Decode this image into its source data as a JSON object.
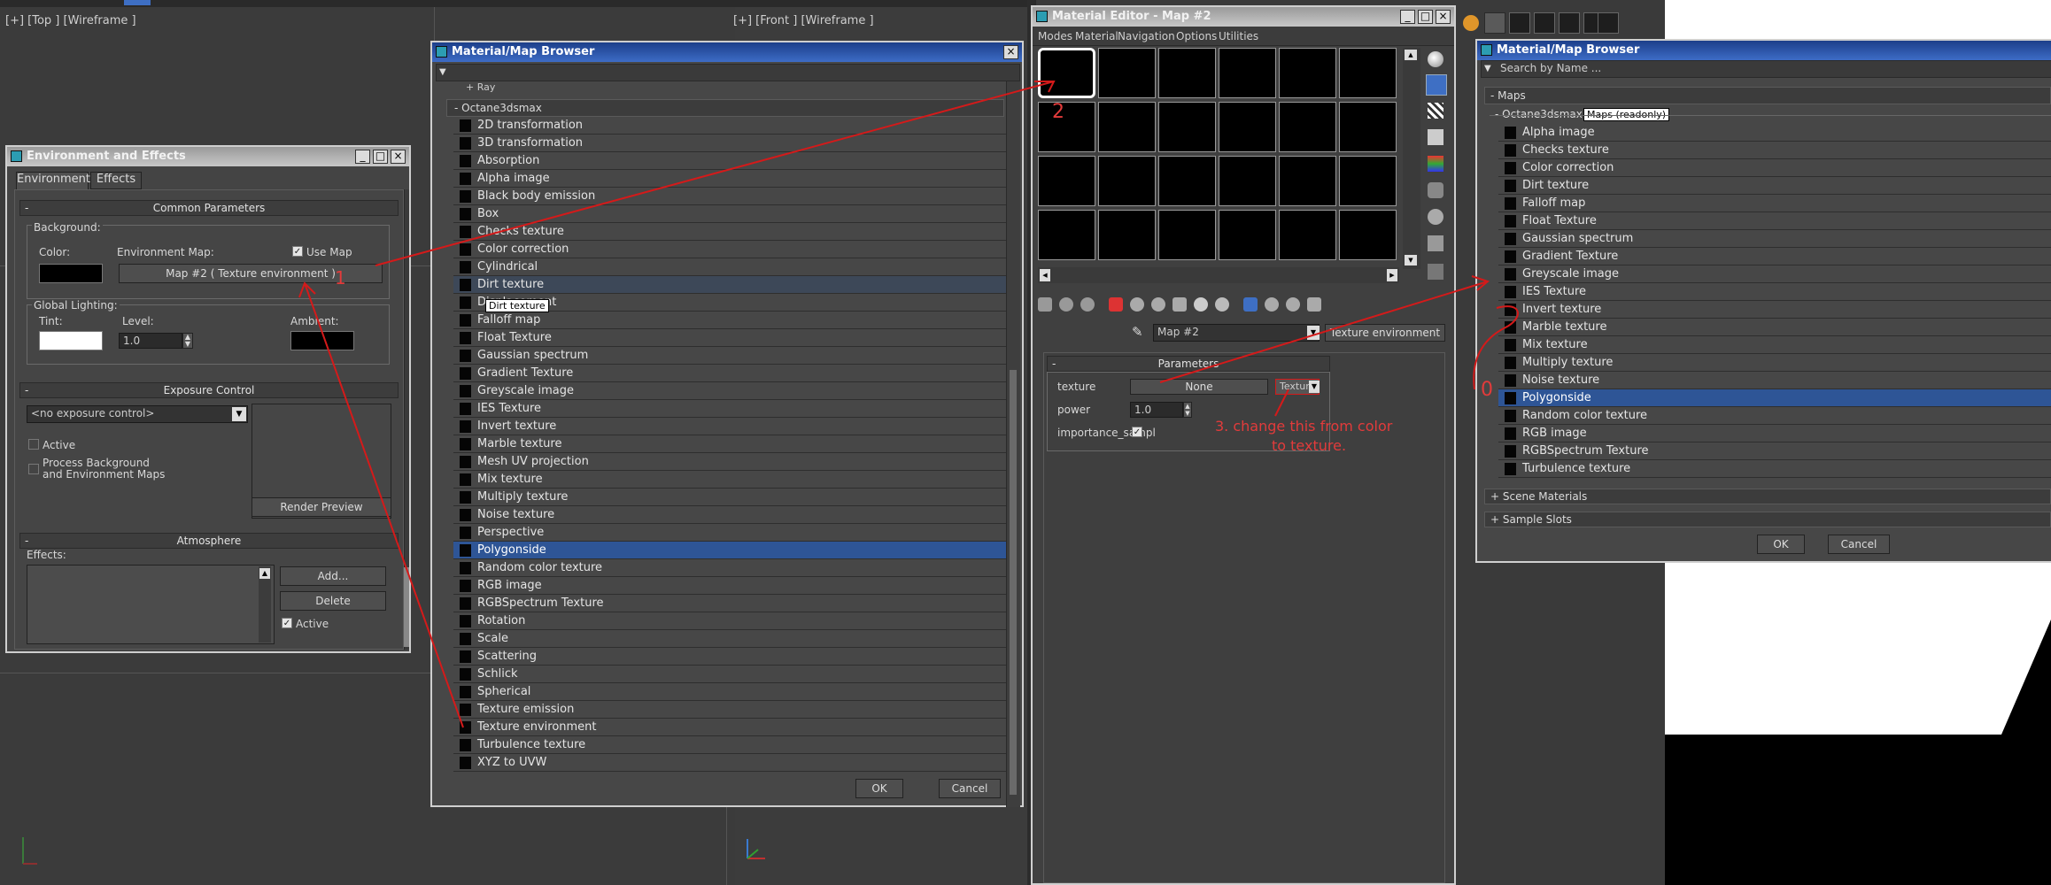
{
  "viewports": {
    "top_label": "[+] [Top ] [Wireframe ]",
    "front_label": "[+] [Front ] [Wireframe ]"
  },
  "env": {
    "title": "Environment and Effects",
    "tabs": [
      "Environment",
      "Effects"
    ],
    "common_params": "Common Parameters",
    "background": "Background:",
    "color": "Color:",
    "env_map": "Environment Map:",
    "use_map": "Use Map",
    "map_button": "Map #2  ( Texture environment )",
    "global_lighting": "Global Lighting:",
    "tint": "Tint:",
    "level": "Level:",
    "level_value": "1.0",
    "ambient": "Ambient:",
    "exposure_control": "Exposure Control",
    "exposure_select": "<no exposure control>",
    "active": "Active",
    "process_bg": "Process Background",
    "process_bg2": "and Environment Maps",
    "render_preview": "Render Preview",
    "atmosphere": "Atmosphere",
    "effects": "Effects:",
    "add": "Add...",
    "delete": "Delete",
    "active2": "Active"
  },
  "browser1": {
    "title": "Material/Map Browser",
    "top_cut": "+ Ray",
    "group": "- Octane3dsmax",
    "items": [
      "2D transformation",
      "3D transformation",
      "Absorption",
      "Alpha image",
      "Black body emission",
      "Box",
      "Checks texture",
      "Color correction",
      "Cylindrical",
      "Dirt texture",
      "Displacement",
      "Falloff map",
      "Float Texture",
      "Gaussian spectrum",
      "Gradient Texture",
      "Greyscale image",
      "IES Texture",
      "Invert texture",
      "Marble texture",
      "Mesh UV projection",
      "Mix texture",
      "Multiply texture",
      "Noise texture",
      "Perspective",
      "Polygonside",
      "Random color texture",
      "RGB image",
      "RGBSpectrum Texture",
      "Rotation",
      "Scale",
      "Scattering",
      "Schlick",
      "Spherical",
      "Texture emission",
      "Texture environment",
      "Turbulence texture",
      "XYZ to UVW"
    ],
    "tooltip": "Dirt texture",
    "ok": "OK",
    "cancel": "Cancel"
  },
  "mat_editor": {
    "title": "Material Editor - Map #2",
    "menu": [
      "Modes",
      "Material",
      "Navigation",
      "Options",
      "Utilities"
    ],
    "map_name": "Map #2",
    "map_type": "Texture environment",
    "parameters": "Parameters",
    "texture_label": "texture",
    "texture_value": "None",
    "texture_type": "Texture",
    "power_label": "power",
    "power_value": "1.0",
    "importance_label": "importance_sampl"
  },
  "browser2": {
    "title": "Material/Map Browser",
    "search": "Search by Name ...",
    "maps": "- Maps",
    "group": "- Octane3dsmax",
    "group_tag": "Maps (readonly)",
    "items": [
      "Alpha image",
      "Checks texture",
      "Color correction",
      "Dirt texture",
      "Falloff map",
      "Float Texture",
      "Gaussian spectrum",
      "Gradient Texture",
      "Greyscale image",
      "IES Texture",
      "Invert texture",
      "Marble texture",
      "Mix texture",
      "Multiply texture",
      "Noise texture",
      "Polygonside",
      "Random color texture",
      "RGB image",
      "RGBSpectrum Texture",
      "Turbulence texture"
    ],
    "scene_materials": "+ Scene Materials",
    "sample_slots": "+ Sample Slots",
    "ok": "OK",
    "cancel": "Cancel"
  },
  "annotations": {
    "n1": "1",
    "n2": "2",
    "n3": "3. change this from color",
    "n3b": "to texture.",
    "n0": "0"
  },
  "colors": {
    "selection": "#2e5596",
    "annotation": "#d41a1a",
    "titlebar": "#1c3f8a"
  }
}
